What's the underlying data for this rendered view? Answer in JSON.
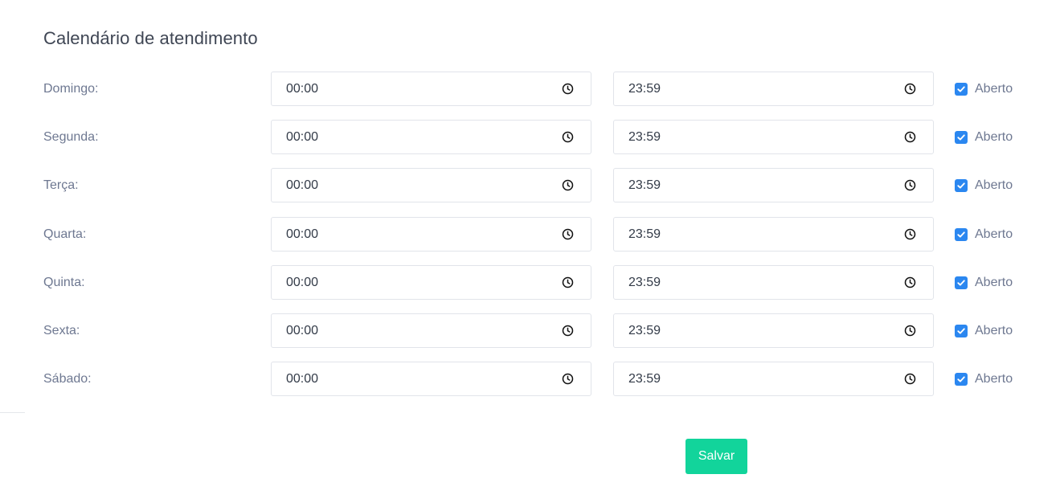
{
  "page": {
    "title": "Calendário de atendimento"
  },
  "schedule": {
    "days": [
      {
        "label": "Domingo:",
        "start": "00:00",
        "end": "23:59",
        "open_label": "Aberto",
        "open": true
      },
      {
        "label": "Segunda:",
        "start": "00:00",
        "end": "23:59",
        "open_label": "Aberto",
        "open": true
      },
      {
        "label": "Terça:",
        "start": "00:00",
        "end": "23:59",
        "open_label": "Aberto",
        "open": true
      },
      {
        "label": "Quarta:",
        "start": "00:00",
        "end": "23:59",
        "open_label": "Aberto",
        "open": true
      },
      {
        "label": "Quinta:",
        "start": "00:00",
        "end": "23:59",
        "open_label": "Aberto",
        "open": true
      },
      {
        "label": "Sexta:",
        "start": "00:00",
        "end": "23:59",
        "open_label": "Aberto",
        "open": true
      },
      {
        "label": "Sábado:",
        "start": "00:00",
        "end": "23:59",
        "open_label": "Aberto",
        "open": true
      }
    ]
  },
  "actions": {
    "save_label": "Salvar"
  },
  "icons": {
    "time": "clock-icon",
    "checkbox": "check-icon"
  },
  "colors": {
    "accent_checkbox": "#2b87f0",
    "save_button": "#12d49b",
    "label_text": "#6e7891",
    "title_text": "#3f4654"
  }
}
